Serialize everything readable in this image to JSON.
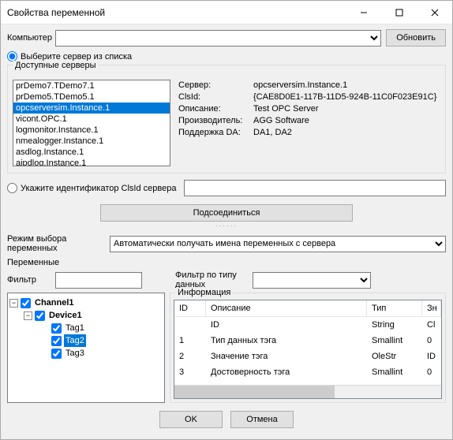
{
  "title": "Свойства переменной",
  "computer_label": "Компьютер",
  "refresh_btn": "Обновить",
  "radio_server_list": "Выберите сервер из списка",
  "servers_legend": "Доступные серверы",
  "server_list": [
    "prDemo7.TDemo7.1",
    "prDemo5.TDemo5.1",
    "opcserversim.Instance.1",
    "vicont.OPC.1",
    "logmonitor.Instance.1",
    "nmealogger.Instance.1",
    "asdlog.Instance.1",
    "aipdlog.Instance.1"
  ],
  "selected_server_index": 2,
  "details": {
    "server_lbl": "Сервер:",
    "server_val": "opcserversim.Instance.1",
    "clsid_lbl": "ClsId:",
    "clsid_val": "{CAE8D0E1-117B-11D5-924B-11C0F023E91C}",
    "desc_lbl": "Описание:",
    "desc_val": "Test OPC Server",
    "vendor_lbl": "Производитель:",
    "vendor_val": "AGG Software",
    "da_lbl": "Поддержка DA:",
    "da_val": "DA1, DA2"
  },
  "radio_clsid": "Укажите идентификатор ClsId сервера",
  "connect_btn": "Подсоединиться",
  "mode_label": "Режим выбора переменных",
  "mode_value": "Автоматически получать имена переменных с сервера",
  "vars_legend": "Переменные",
  "filter_label": "Фильтр",
  "type_filter_label": "Фильтр по типу данных",
  "tree": {
    "root": "Channel1",
    "child": "Device1",
    "tags": [
      "Tag1",
      "Tag2",
      "Tag3"
    ],
    "selected_tag_index": 1
  },
  "info_legend": "Информация",
  "table": {
    "headers": {
      "id": "ID",
      "desc": "Описание",
      "type": "Тип",
      "extra": "Зн"
    },
    "rows": [
      {
        "id": "",
        "desc": "ID",
        "type": "String",
        "extra": "Cl"
      },
      {
        "id": "1",
        "desc": "Тип данных тэга",
        "type": "Smallint",
        "extra": "0"
      },
      {
        "id": "2",
        "desc": "Значение тэга",
        "type": "OleStr",
        "extra": "ID"
      },
      {
        "id": "3",
        "desc": "Достоверность тэга",
        "type": "Smallint",
        "extra": "0"
      }
    ]
  },
  "ok_btn": "OK",
  "cancel_btn": "Отмена"
}
